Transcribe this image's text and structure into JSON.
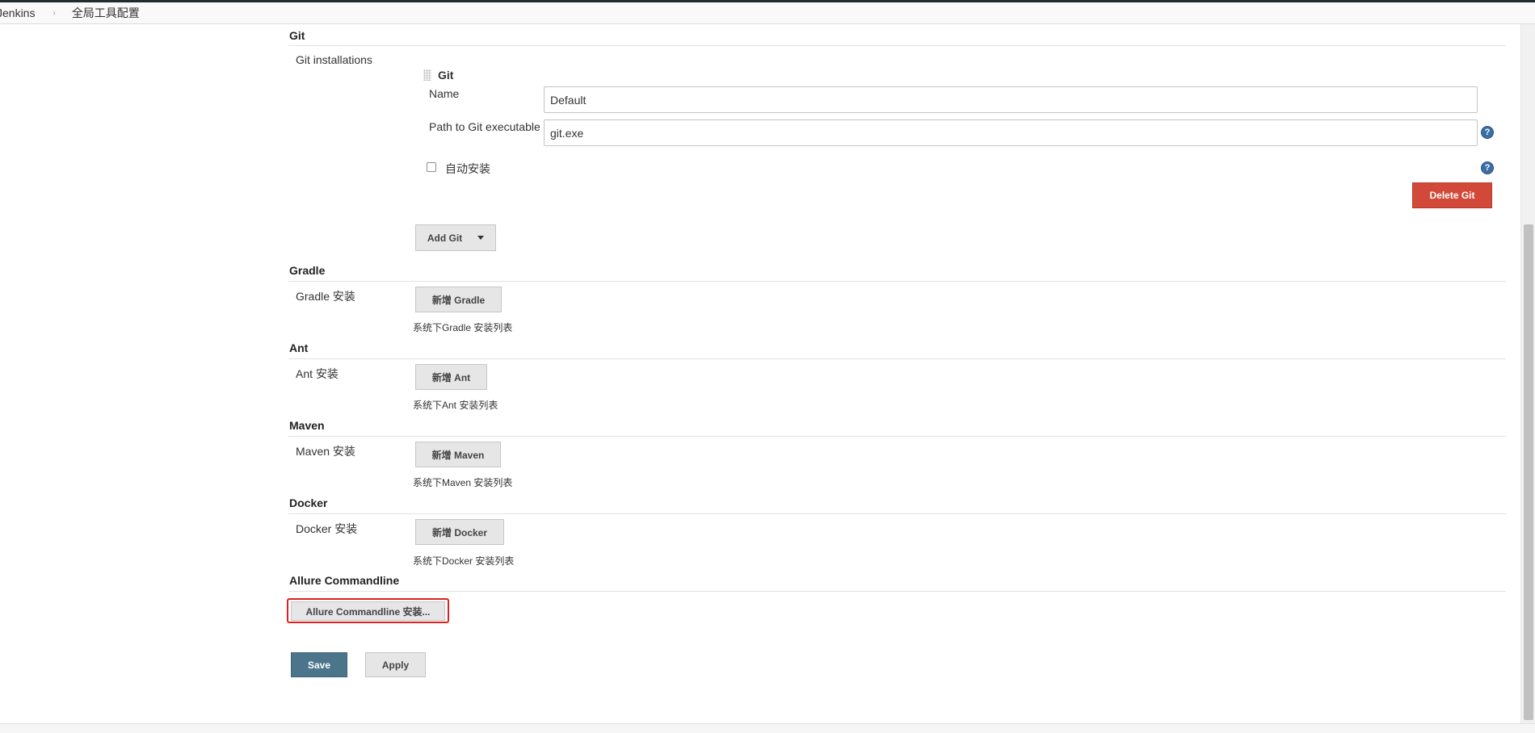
{
  "breadcrumb": {
    "home": "Jenkins",
    "separator": "›",
    "page": "全局工具配置"
  },
  "git": {
    "section_title": "Git",
    "installations_label": "Git installations",
    "item_title": "Git",
    "name_label": "Name",
    "name_value": "Default",
    "path_label": "Path to Git executable",
    "path_value": "git.exe",
    "auto_install_label": "自动安装",
    "delete_button": "Delete Git",
    "add_button": "Add Git"
  },
  "gradle": {
    "section_title": "Gradle",
    "label": "Gradle 安装",
    "button": "新增 Gradle",
    "note": "系统下Gradle 安装列表"
  },
  "ant": {
    "section_title": "Ant",
    "label": "Ant 安装",
    "button": "新增 Ant",
    "note": "系统下Ant 安装列表"
  },
  "maven": {
    "section_title": "Maven",
    "label": "Maven 安装",
    "button": "新增 Maven",
    "note": "系统下Maven 安装列表"
  },
  "docker": {
    "section_title": "Docker",
    "label": "Docker 安装",
    "button": "新增 Docker",
    "note": "系统下Docker 安装列表"
  },
  "allure": {
    "section_title": "Allure Commandline",
    "button": "Allure Commandline 安装..."
  },
  "actions": {
    "save": "Save",
    "apply": "Apply"
  },
  "icons": {
    "help": "?",
    "dropdown": "chevron-down-icon",
    "drag": "drag-handle-icon"
  },
  "colors": {
    "save": "#4b758b",
    "delete": "#d24939",
    "highlight": "#e02020",
    "help": "#3a6ea5"
  }
}
